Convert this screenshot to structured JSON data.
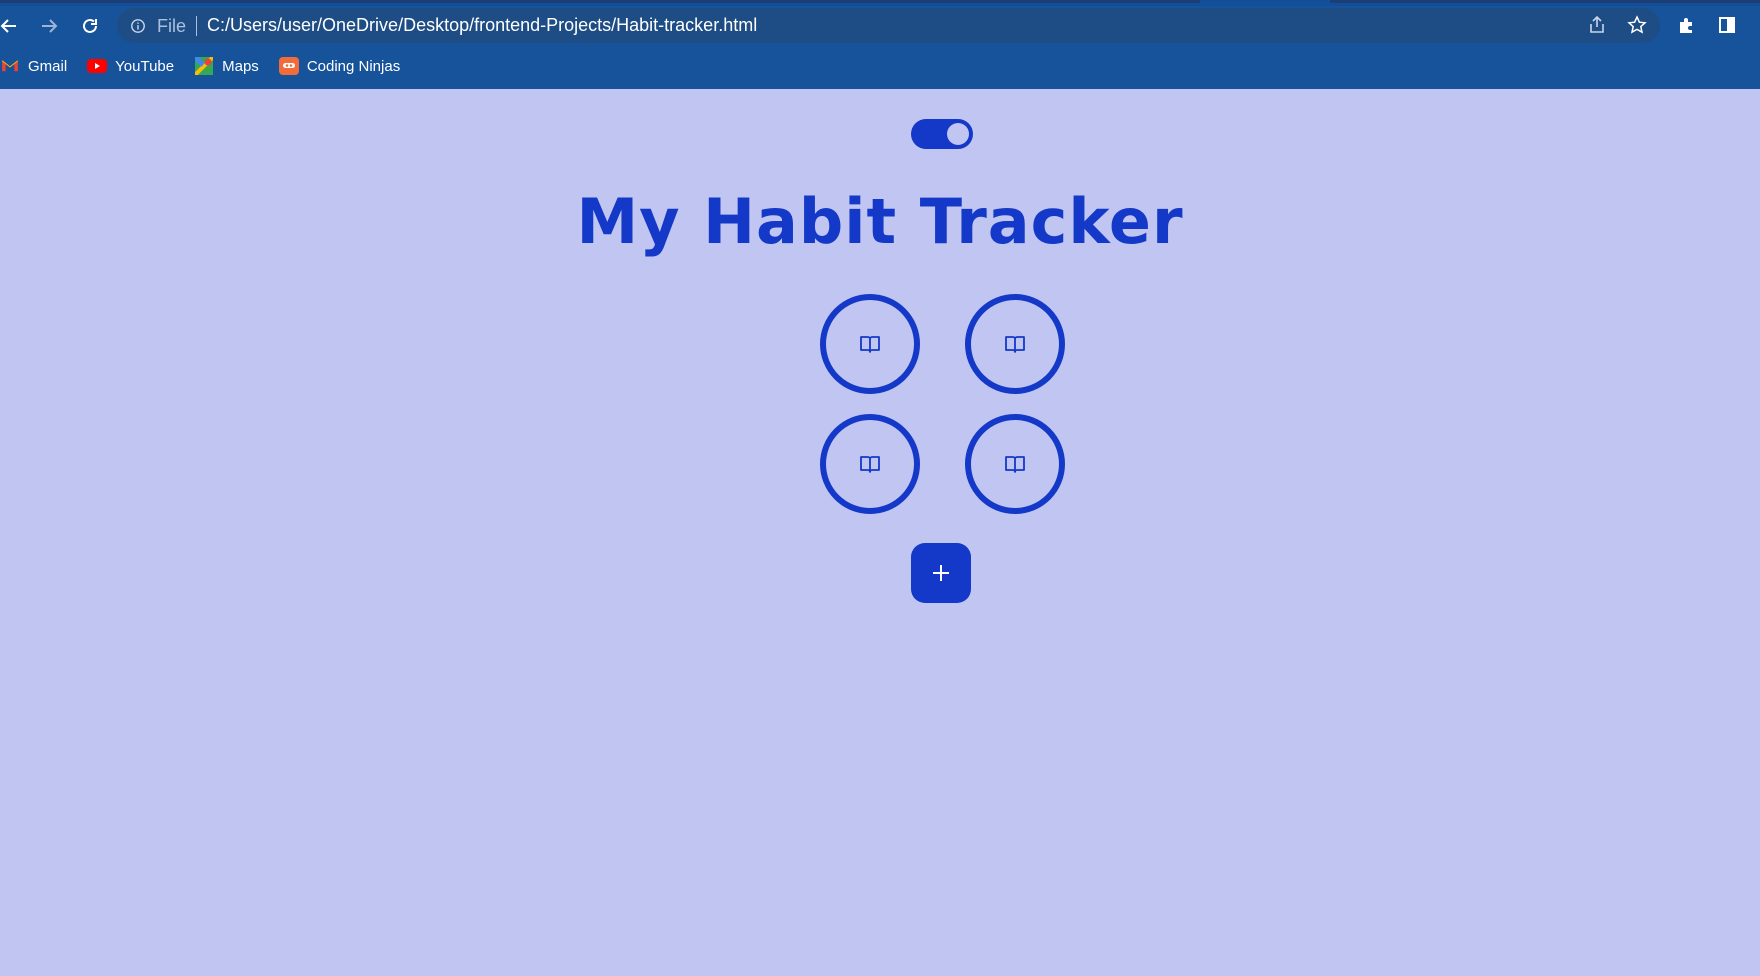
{
  "browser": {
    "url_scheme_label": "File",
    "url": "C:/Users/user/OneDrive/Desktop/frontend-Projects/Habit-tracker.html",
    "bookmarks": [
      {
        "label": "Gmail",
        "icon": "gmail-icon"
      },
      {
        "label": "YouTube",
        "icon": "youtube-icon"
      },
      {
        "label": "Maps",
        "icon": "maps-icon"
      },
      {
        "label": "Coding Ninjas",
        "icon": "coding-ninjas-icon"
      }
    ]
  },
  "app": {
    "title": "My Habit Tracker",
    "theme_toggle": {
      "on": true
    },
    "habits": [
      {
        "icon": "book-icon"
      },
      {
        "icon": "book-icon"
      },
      {
        "icon": "book-icon"
      },
      {
        "icon": "book-icon"
      }
    ],
    "add_button": {
      "icon": "plus-icon"
    }
  },
  "colors": {
    "page_background": "#c0c5f2",
    "accent": "#1438c7",
    "chrome": "#17539b"
  }
}
